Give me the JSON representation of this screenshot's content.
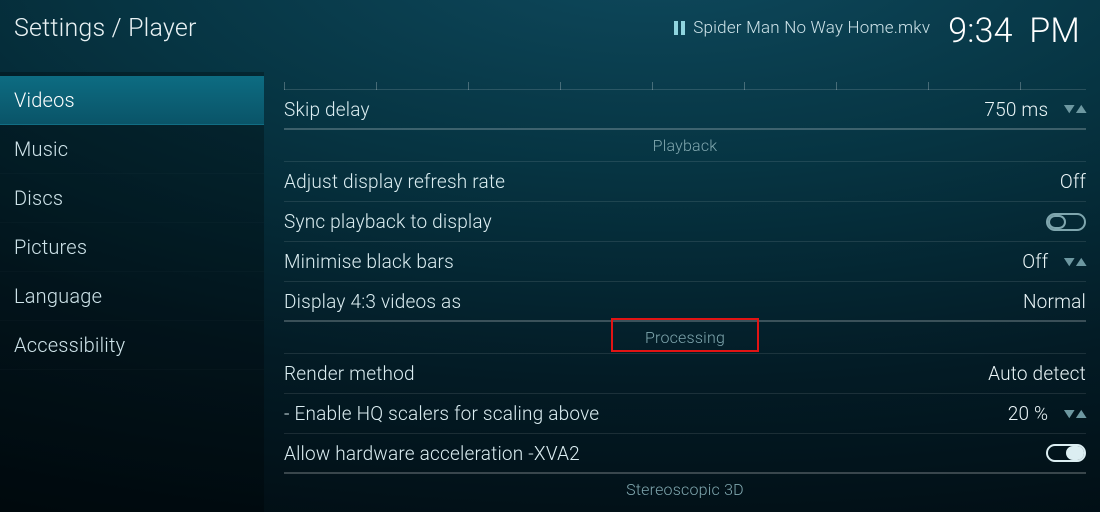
{
  "header": {
    "breadcrumb": "Settings / Player",
    "now_playing": "Spider Man No Way Home.mkv",
    "clock": "9:34",
    "clock_ampm": "PM"
  },
  "sidebar": {
    "items": [
      {
        "id": "videos",
        "label": "Videos",
        "active": true
      },
      {
        "id": "music",
        "label": "Music",
        "active": false
      },
      {
        "id": "discs",
        "label": "Discs",
        "active": false
      },
      {
        "id": "pictures",
        "label": "Pictures",
        "active": false
      },
      {
        "id": "language",
        "label": "Language",
        "active": false
      },
      {
        "id": "accessibility",
        "label": "Accessibility",
        "active": false
      }
    ]
  },
  "sections": {
    "s0": {
      "rows": {
        "skip_delay": {
          "label": "Skip delay",
          "value": "750 ms"
        }
      }
    },
    "playback": {
      "title": "Playback",
      "rows": {
        "adjust_refresh": {
          "label": "Adjust display refresh rate",
          "value": "Off"
        },
        "sync_playback": {
          "label": "Sync playback to display",
          "toggle": false
        },
        "min_blackbars": {
          "label": "Minimise black bars",
          "value": "Off"
        },
        "display_43": {
          "label": "Display 4:3 videos as",
          "value": "Normal"
        }
      }
    },
    "processing": {
      "title": "Processing",
      "highlighted": true,
      "rows": {
        "render_method": {
          "label": "Render method",
          "value": "Auto detect"
        },
        "hq_scalers": {
          "label": "- Enable HQ scalers for scaling above",
          "value": "20 %"
        },
        "hw_accel": {
          "label": "Allow hardware acceleration -XVA2",
          "toggle": true
        }
      }
    },
    "stereo3d": {
      "title": "Stereoscopic 3D"
    }
  }
}
